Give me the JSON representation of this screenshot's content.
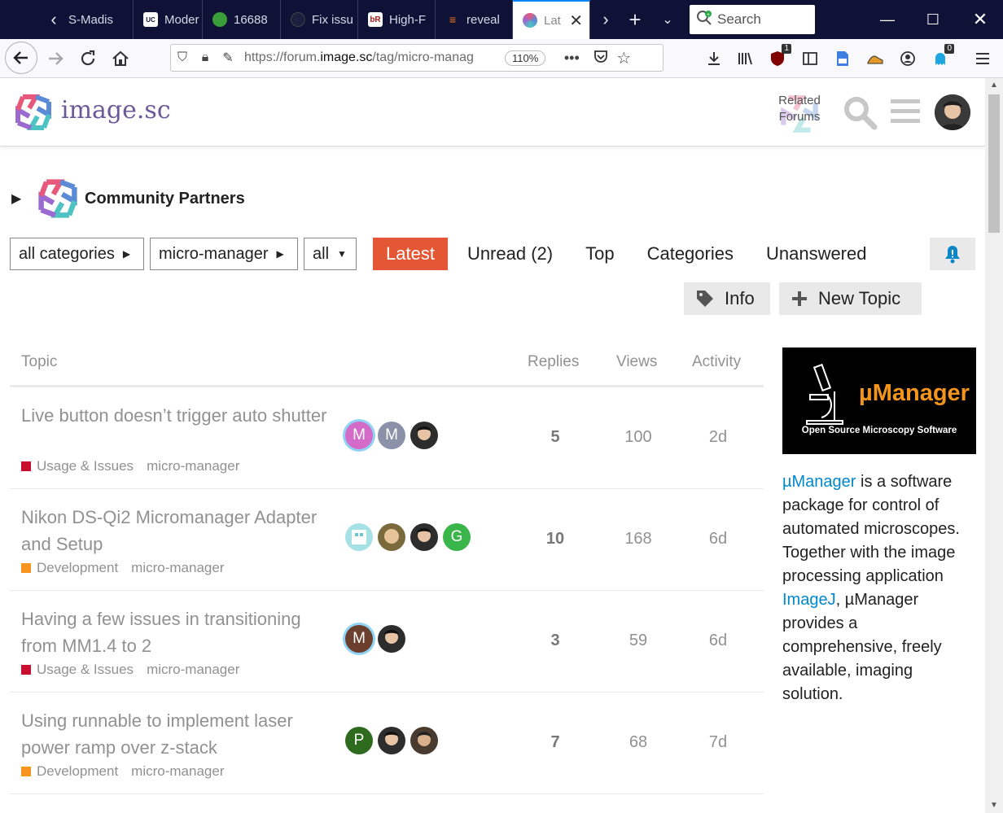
{
  "browser": {
    "tabs": [
      {
        "label": "S-Madis",
        "icon": "madison-favicon"
      },
      {
        "label": "Moder",
        "icon": "ucsf-favicon"
      },
      {
        "label": "16688",
        "icon": "raspberry-favicon"
      },
      {
        "label": "Fix issu",
        "icon": "github-favicon"
      },
      {
        "label": "High-F",
        "icon": "biorxiv-favicon"
      },
      {
        "label": "reveal",
        "icon": "stackoverflow-favicon"
      },
      {
        "label": "Lat",
        "icon": "imagesc-favicon"
      }
    ],
    "search_placeholder": "Search",
    "url_prefix": "https://forum.",
    "url_domain": "image.sc",
    "url_path": "/tag/micro-manag",
    "zoom": "110%",
    "ublock_badge": "1",
    "ghostery_badge": "0"
  },
  "header": {
    "site_name": "image.sc",
    "related_forums": "Related Forums"
  },
  "partners": {
    "label": "Community Partners"
  },
  "filters": {
    "category": "all categories",
    "tag": "micro-manager",
    "subset": "all"
  },
  "nav": {
    "latest": "Latest",
    "unread": "Unread (2)",
    "top": "Top",
    "categories": "Categories",
    "unanswered": "Unanswered"
  },
  "actions": {
    "info": "Info",
    "new_topic": "New Topic"
  },
  "table": {
    "headers": {
      "topic": "Topic",
      "replies": "Replies",
      "views": "Views",
      "activity": "Activity"
    },
    "rows": [
      {
        "title": "Live button doesn’t trigger auto shutter",
        "category": "Usage & Issues",
        "category_color": "#c8102e",
        "tag": "micro-manager",
        "replies": "5",
        "views": "100",
        "activity": "2d",
        "posters": [
          {
            "letter": "M",
            "color": "#d46bc8",
            "ring": true
          },
          {
            "letter": "M",
            "color": "#8a91a8",
            "ring": false
          },
          {
            "letter": "",
            "color": "#2d2d2d",
            "ring": false
          }
        ]
      },
      {
        "title": "Nikon DS-Qi2 Micromanager Adapter and Setup",
        "category": "Development",
        "category_color": "#f7941d",
        "tag": "micro-manager",
        "replies": "10",
        "views": "168",
        "activity": "6d",
        "posters": [
          {
            "letter": "",
            "color": "#a6e1e6",
            "ring": false
          },
          {
            "letter": "",
            "color": "#7a6a3c",
            "ring": false
          },
          {
            "letter": "",
            "color": "#2d2d2d",
            "ring": false
          },
          {
            "letter": "G",
            "color": "#3ab54a",
            "ring": false
          }
        ]
      },
      {
        "title": "Having a few issues in transitioning from MM1.4 to 2",
        "category": "Usage & Issues",
        "category_color": "#c8102e",
        "tag": "micro-manager",
        "replies": "3",
        "views": "59",
        "activity": "6d",
        "posters": [
          {
            "letter": "M",
            "color": "#6b3e2e",
            "ring": true
          },
          {
            "letter": "",
            "color": "#2d2d2d",
            "ring": false
          }
        ]
      },
      {
        "title": "Using runnable to implement laser power ramp over z-stack",
        "category": "Development",
        "category_color": "#f7941d",
        "tag": "micro-manager",
        "replies": "7",
        "views": "68",
        "activity": "7d",
        "posters": [
          {
            "letter": "P",
            "color": "#2e6b1f",
            "ring": false
          },
          {
            "letter": "",
            "color": "#2d2d2d",
            "ring": false
          },
          {
            "letter": "",
            "color": "#4a3b30",
            "ring": false
          }
        ]
      }
    ]
  },
  "sidebar": {
    "banner_title": "µManager",
    "banner_subtitle": "Open Source Microscopy Software",
    "link1": "µManager",
    "text1": " is a software package for control of automated microscopes. Together with the image processing application ",
    "link2": "ImageJ",
    "text2": ", µManager provides a comprehensive, freely available, imaging solution."
  },
  "colors": {
    "accent": "#e45735",
    "link": "#0088cc",
    "chrome_dark": "#0f1136"
  }
}
